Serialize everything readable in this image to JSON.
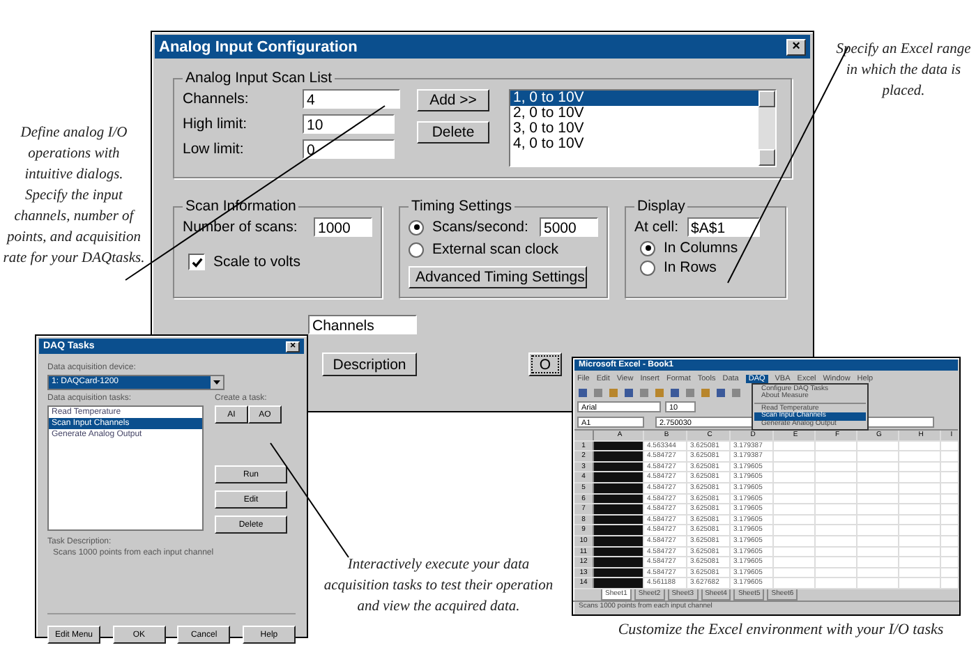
{
  "captions": [
    {
      "kind": "left",
      "text": "Define analog I/O operations with intuitive dialogs. Specify the input channels, number of points, and acquisition rate for your DAQtasks."
    },
    {
      "kind": "right",
      "text": "Specify an Excel range in which the data is placed."
    },
    {
      "kind": "middle",
      "text": "Interactively execute your data acquisition tasks to test their operation and view the acquired data."
    },
    {
      "kind": "bottom",
      "text": "Customize the Excel environment with your I/O tasks"
    }
  ],
  "dialog": {
    "title": "Analog Input Configuration",
    "close": "×",
    "scan_list": {
      "legend": "Analog Input Scan List",
      "fields": [
        {
          "label": "Channels:",
          "value": "4"
        },
        {
          "label": "High limit:",
          "value": "10"
        },
        {
          "label": "Low limit:",
          "value": "0"
        }
      ],
      "buttons": [
        "Add >>",
        "Delete"
      ],
      "channels": [
        {
          "label": "1, 0 to 10V",
          "selected": true
        },
        {
          "label": "2, 0 to 10V",
          "selected": false
        },
        {
          "label": "3, 0 to 10V",
          "selected": false
        },
        {
          "label": "4, 0 to 10V",
          "selected": false
        }
      ]
    },
    "scan_info": {
      "legend": "Scan Information",
      "field": {
        "label": "Number of scans:",
        "value": "1000"
      },
      "checkbox": {
        "label": "Scale to volts",
        "checked": true
      }
    },
    "timing": {
      "legend": "Timing Settings",
      "radios": [
        {
          "label": "Scans/second:",
          "selected": true,
          "value": "5000"
        },
        {
          "label": "External scan clock",
          "selected": false
        }
      ],
      "button": "Advanced Timing Settings"
    },
    "display": {
      "legend": "Display",
      "field": {
        "label": "At cell:",
        "value": "$A$1"
      },
      "radios": [
        {
          "label": "In Columns",
          "selected": true
        },
        {
          "label": "In Rows",
          "selected": false
        }
      ]
    },
    "name_field": {
      "value": "Channels"
    },
    "buttons": [
      "Description",
      "O"
    ]
  },
  "tasks_window": {
    "title": "DAQ Tasks",
    "close": "×",
    "device_label": "Data acquisition device:",
    "device": "1: DAQCard-1200",
    "tasks_label": "Data acquisition tasks:",
    "tasks": [
      {
        "label": "Read Temperature",
        "selected": false
      },
      {
        "label": "Scan Input Channels",
        "selected": true
      },
      {
        "label": "Generate Analog Output",
        "selected": false
      }
    ],
    "create_label": "Create a task:",
    "create_buttons": [
      "AI",
      "AO"
    ],
    "side_buttons": [
      "Run",
      "Edit",
      "Delete"
    ],
    "description_label": "Task Description:",
    "description": "Scans 1000 points from each input channel",
    "bottom_buttons": [
      "Edit Menu",
      "OK",
      "Cancel",
      "Help"
    ]
  },
  "excel": {
    "title": "Microsoft Excel - Book1",
    "menu": [
      {
        "label": "File",
        "selected": false
      },
      {
        "label": "Edit",
        "selected": false
      },
      {
        "label": "View",
        "selected": false
      },
      {
        "label": "Insert",
        "selected": false
      },
      {
        "label": "Format",
        "selected": false
      },
      {
        "label": "Tools",
        "selected": false
      },
      {
        "label": "Data",
        "selected": false
      },
      {
        "label": "DAQ",
        "selected": true
      },
      {
        "label": "VBA",
        "selected": false
      },
      {
        "label": "Excel",
        "selected": false
      },
      {
        "label": "Window",
        "selected": false
      },
      {
        "label": "Help",
        "selected": false
      }
    ],
    "dropdown": [
      {
        "label": "Configure DAQ Tasks",
        "selected": false,
        "separator_after": false
      },
      {
        "label": "About Measure",
        "selected": false,
        "separator_after": true
      },
      {
        "label": "Read Temperature",
        "selected": false,
        "separator_after": false
      },
      {
        "label": "Scan Input Channels",
        "selected": true,
        "separator_after": false
      },
      {
        "label": "Generate Analog Output",
        "selected": false,
        "separator_after": false
      }
    ],
    "font": "Arial",
    "size": "10",
    "name_box": "A1",
    "formula": "2.750030",
    "columns": [
      "A",
      "B",
      "C",
      "D",
      "E",
      "F",
      "G",
      "H",
      "I"
    ],
    "rows": [
      {
        "n": "1",
        "cells": [
          "",
          "4.563344",
          "3.625081",
          "3.179387"
        ]
      },
      {
        "n": "2",
        "cells": [
          "",
          "4.584727",
          "3.625081",
          "3.179387"
        ]
      },
      {
        "n": "3",
        "cells": [
          "",
          "4.584727",
          "3.625081",
          "3.179605"
        ]
      },
      {
        "n": "4",
        "cells": [
          "",
          "4.584727",
          "3.625081",
          "3.179605"
        ]
      },
      {
        "n": "5",
        "cells": [
          "",
          "4.584727",
          "3.625081",
          "3.179605"
        ]
      },
      {
        "n": "6",
        "cells": [
          "",
          "4.584727",
          "3.625081",
          "3.179605"
        ]
      },
      {
        "n": "7",
        "cells": [
          "",
          "4.584727",
          "3.625081",
          "3.179605"
        ]
      },
      {
        "n": "8",
        "cells": [
          "",
          "4.584727",
          "3.625081",
          "3.179605"
        ]
      },
      {
        "n": "9",
        "cells": [
          "",
          "4.584727",
          "3.625081",
          "3.179605"
        ]
      },
      {
        "n": "10",
        "cells": [
          "",
          "4.584727",
          "3.625081",
          "3.179605"
        ]
      },
      {
        "n": "11",
        "cells": [
          "",
          "4.584727",
          "3.625081",
          "3.179605"
        ]
      },
      {
        "n": "12",
        "cells": [
          "",
          "4.584727",
          "3.625081",
          "3.179605"
        ]
      },
      {
        "n": "13",
        "cells": [
          "",
          "4.584727",
          "3.625081",
          "3.179605"
        ]
      },
      {
        "n": "14",
        "cells": [
          "",
          "4.561188",
          "3.627682",
          "3.179605"
        ]
      }
    ],
    "sheets": [
      {
        "label": "Sheet1",
        "selected": true
      },
      {
        "label": "Sheet2",
        "selected": false
      },
      {
        "label": "Sheet3",
        "selected": false
      },
      {
        "label": "Sheet4",
        "selected": false
      },
      {
        "label": "Sheet5",
        "selected": false
      },
      {
        "label": "Sheet6",
        "selected": false
      }
    ],
    "status": "Scans 1000 points from each input channel"
  }
}
